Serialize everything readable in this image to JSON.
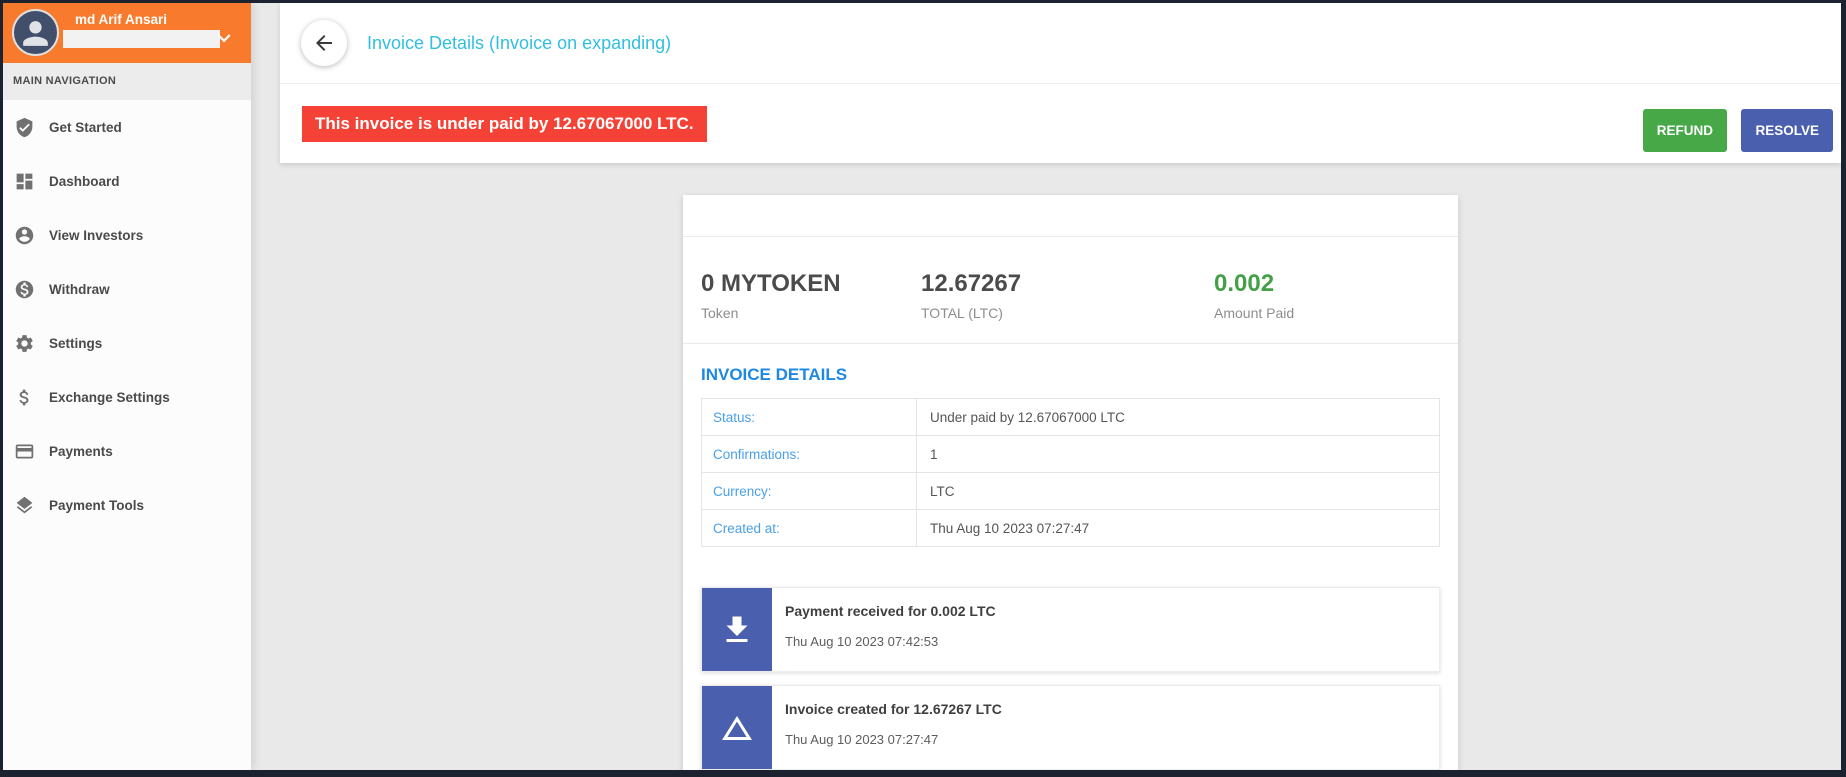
{
  "user": {
    "name": "md Arif Ansari"
  },
  "sidebar": {
    "section_label": "MAIN NAVIGATION",
    "items": [
      {
        "label": "Get Started",
        "icon": "shield-check-icon"
      },
      {
        "label": "Dashboard",
        "icon": "dashboard-grid-icon"
      },
      {
        "label": "View Investors",
        "icon": "person-circle-icon"
      },
      {
        "label": "Withdraw",
        "icon": "money-circle-icon"
      },
      {
        "label": "Settings",
        "icon": "gear-icon"
      },
      {
        "label": "Exchange Settings",
        "icon": "dollar-icon"
      },
      {
        "label": "Payments",
        "icon": "credit-card-icon"
      },
      {
        "label": "Payment Tools",
        "icon": "layers-icon"
      }
    ]
  },
  "header": {
    "title": "Invoice Details (Invoice on expanding)"
  },
  "alert": {
    "message": "This invoice is under paid by 12.67067000 LTC."
  },
  "actions": {
    "refund_label": "REFUND",
    "resolve_label": "RESOLVE"
  },
  "invoice": {
    "stats": [
      {
        "value": "0 MYTOKEN",
        "label": "Token"
      },
      {
        "value": "12.67267",
        "label": "TOTAL (LTC)"
      },
      {
        "value": "0.002",
        "label": "Amount Paid"
      }
    ],
    "details_heading": "INVOICE DETAILS",
    "details": [
      {
        "label": "Status:",
        "value": "Under paid by 12.67067000 LTC"
      },
      {
        "label": "Confirmations:",
        "value": "1"
      },
      {
        "label": "Currency:",
        "value": "LTC"
      },
      {
        "label": "Created at:",
        "value": "Thu Aug 10 2023 07:27:47"
      }
    ],
    "events": [
      {
        "icon": "download-icon",
        "title": "Payment received for 0.002 LTC",
        "timestamp": "Thu Aug 10 2023 07:42:53"
      },
      {
        "icon": "triangle-icon",
        "title": "Invoice created for 12.67267 LTC",
        "timestamp": "Thu Aug 10 2023 07:27:47"
      }
    ]
  },
  "colors": {
    "sidebar_header_orange": "#f87b2d",
    "alert_red": "#f44336",
    "refund_green": "#46a847",
    "resolve_indigo": "#4a5fae",
    "title_cyan": "#31bfdf",
    "link_blue": "#4aa0e8",
    "heading_blue": "#1e88e5",
    "amount_green": "#43a047",
    "event_icon_indigo": "#4a5fad"
  }
}
